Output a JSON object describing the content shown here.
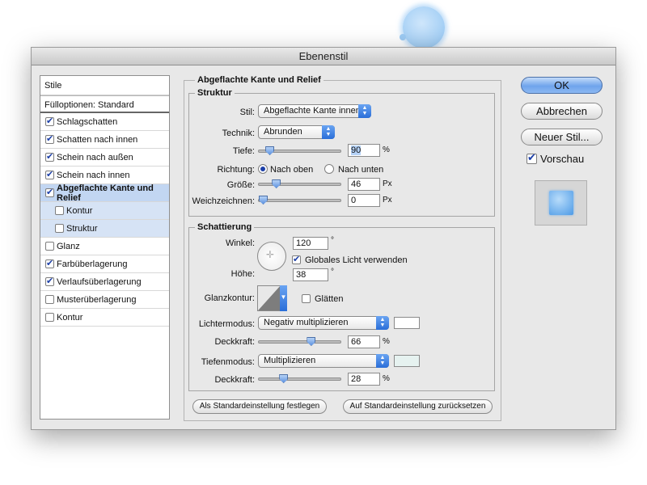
{
  "window": {
    "title": "Ebenenstil"
  },
  "left_list": {
    "header": "Stile",
    "fill_options": "Fülloptionen: Standard",
    "items": [
      {
        "label": "Schlagschatten",
        "checked": true,
        "sub": false,
        "active": false
      },
      {
        "label": "Schatten nach innen",
        "checked": true,
        "sub": false,
        "active": false
      },
      {
        "label": "Schein nach außen",
        "checked": true,
        "sub": false,
        "active": false
      },
      {
        "label": "Schein nach innen",
        "checked": true,
        "sub": false,
        "active": false
      },
      {
        "label": "Abgeflachte Kante und Relief",
        "checked": true,
        "sub": false,
        "active": true
      },
      {
        "label": "Kontur",
        "checked": false,
        "sub": true,
        "active": false
      },
      {
        "label": "Struktur",
        "checked": false,
        "sub": true,
        "active": false
      },
      {
        "label": "Glanz",
        "checked": false,
        "sub": false,
        "active": false
      },
      {
        "label": "Farbüberlagerung",
        "checked": true,
        "sub": false,
        "active": false
      },
      {
        "label": "Verlaufsüberlagerung",
        "checked": true,
        "sub": false,
        "active": false
      },
      {
        "label": "Musterüberlagerung",
        "checked": false,
        "sub": false,
        "active": false
      },
      {
        "label": "Kontur",
        "checked": false,
        "sub": false,
        "active": false
      }
    ]
  },
  "bevel": {
    "title": "Abgeflachte Kante und Relief",
    "structure": {
      "title": "Struktur",
      "style_label": "Stil:",
      "style_value": "Abgeflachte Kante innen",
      "technique_label": "Technik:",
      "technique_value": "Abrunden",
      "depth_label": "Tiefe:",
      "depth_value": "90",
      "depth_unit": "%",
      "depth_level": 0.09,
      "direction_label": "Richtung:",
      "direction_up": "Nach oben",
      "direction_down": "Nach unten",
      "direction_selected": "up",
      "size_label": "Größe:",
      "size_value": "46",
      "size_unit": "Px",
      "size_level": 0.18,
      "soften_label": "Weichzeichnen:",
      "soften_value": "0",
      "soften_unit": "Px",
      "soften_level": 0.0
    },
    "shading": {
      "title": "Schattierung",
      "angle_label": "Winkel:",
      "angle_value": "120",
      "angle_unit": "°",
      "global_light_label": "Globales Licht verwenden",
      "global_light_checked": true,
      "altitude_label": "Höhe:",
      "altitude_value": "38",
      "altitude_unit": "°",
      "gloss_label": "Glanzkontur:",
      "antialias_label": "Glätten",
      "antialias_checked": false,
      "highlight_mode_label": "Lichtermodus:",
      "highlight_mode_value": "Negativ multiplizieren",
      "highlight_color": "#ffffff",
      "highlight_opacity_label": "Deckkraft:",
      "highlight_opacity_value": "66",
      "highlight_opacity_unit": "%",
      "highlight_opacity_level": 0.66,
      "shadow_mode_label": "Tiefenmodus:",
      "shadow_mode_value": "Multiplizieren",
      "shadow_color": "#e6f2f0",
      "shadow_opacity_label": "Deckkraft:",
      "shadow_opacity_value": "28",
      "shadow_opacity_unit": "%",
      "shadow_opacity_level": 0.28
    },
    "make_default": "Als Standardeinstellung festlegen",
    "reset_default": "Auf Standardeinstellung zurücksetzen"
  },
  "buttons": {
    "ok": "OK",
    "cancel": "Abbrechen",
    "new_style": "Neuer Stil...",
    "preview_label": "Vorschau",
    "preview_checked": true
  },
  "colors": {
    "accent": "#3b7ddd",
    "selection": "#c2d6f2"
  }
}
